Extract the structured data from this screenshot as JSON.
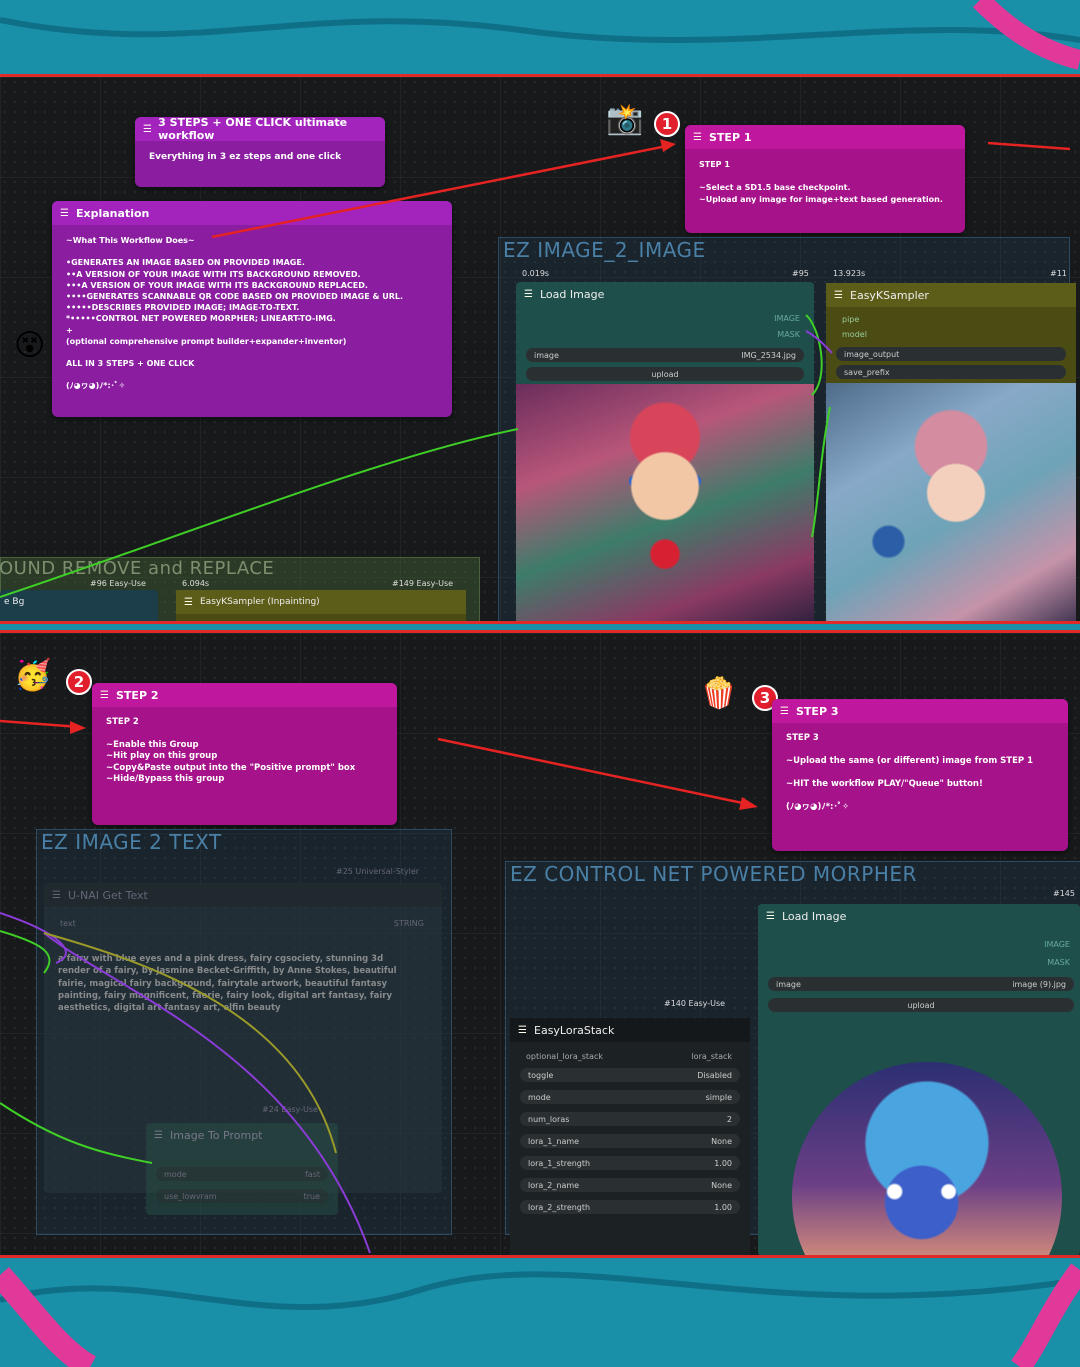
{
  "top_panel": {
    "title_note": {
      "header": "3 STEPS + ONE CLICK ultimate workflow",
      "body": "Everything in 3 ez steps and one click"
    },
    "explanation_note": {
      "header": "Explanation",
      "body": "~What This Workflow Does~\n\n•GENERATES AN IMAGE BASED ON PROVIDED IMAGE.\n••A VERSION OF YOUR IMAGE WITH ITS BACKGROUND REMOVED.\n•••A VERSION OF YOUR IMAGE WITH ITS BACKGROUND REPLACED.\n••••GENERATES SCANNABLE QR CODE BASED ON PROVIDED IMAGE & URL.\n•••••DESCRIBES PROVIDED IMAGE; IMAGE-TO-TEXT.\n*•••••CONTROL NET POWERED MORPHER; LINEART-TO-IMG.\n+\n(optional comprehensive prompt builder+expander+inventor)\n\nALL IN 3 STEPS + ONE CLICK\n\n(ﾉ◕ヮ◕)ﾉ*:･ﾟ✧"
    },
    "step1_note": {
      "header": "STEP 1",
      "body": "STEP 1\n\n~Select a SD1.5 base checkpoint.\n~Upload any image for image+text based generation."
    },
    "step1_badge": "1",
    "group_img2img": {
      "title": "EZ IMAGE_2_IMAGE"
    },
    "load_image_node": {
      "timer": "0.019s",
      "id": "#95",
      "title": "Load Image",
      "out1": "IMAGE",
      "out2": "MASK",
      "widget_label": "image",
      "widget_value": "IMG_2534.jpg",
      "upload": "upload"
    },
    "ksampler_node": {
      "timer": "13.923s",
      "id": "#11",
      "title": "EasyKSampler",
      "in1": "pipe",
      "in2": "model",
      "widget1": "image_output",
      "widget2": "save_prefix"
    },
    "bg_group": {
      "title": "OUND REMOVE and REPLACE",
      "node1_id": "#96 Easy-Use",
      "node1_label": "e Bg",
      "timer": "6.094s",
      "node2_id": "#149 Easy-Use",
      "node2_title": "EasyKSampler (Inpainting)"
    }
  },
  "bottom_panel": {
    "step2_badge": "2",
    "step2_note": {
      "header": "STEP 2",
      "body": "STEP 2\n\n~Enable this Group\n~Hit play on this group\n~Copy&Paste output into the \"Positive prompt\" box\n~Hide/Bypass this group"
    },
    "step3_badge": "3",
    "step3_note": {
      "header": "STEP 3",
      "body": "STEP 3\n\n~Upload the same (or different) image from STEP 1\n\n~HIT the workflow PLAY/\"Queue\" button!\n\n(ﾉ◕ヮ◕)ﾉ*:･ﾟ✧"
    },
    "group_img2text": {
      "title": "EZ IMAGE 2 TEXT",
      "node_id": "#25 Universal-Styler",
      "node_title": "U-NAI Get Text",
      "in_label": "text",
      "out_label": "STRING",
      "text": "a fairy with blue eyes and a pink dress, fairy cgsociety, stunning 3d render of a fairy, by Jasmine Becket-Griffith, by Anne Stokes, beautiful fairie, magical fairy background, fairytale artwork, beautiful fantasy painting, fairy magnificent, faerie, fairy look, digital art fantasy, fairy aesthetics, digital art fantasy art, elfin beauty",
      "node2_id": "#24 Easy-Use",
      "node2_title": "Image To Prompt",
      "node2_w1_label": "mode",
      "node2_w1_value": "fast",
      "node2_w2_label": "use_lowvram",
      "node2_w2_value": "true"
    },
    "group_morpher": {
      "title": "EZ CONTROL NET POWERED MORPHER",
      "id_right": "#145",
      "load_image": {
        "title": "Load Image",
        "out1": "IMAGE",
        "out2": "MASK",
        "widget_label": "image",
        "widget_value": "image (9).jpg",
        "upload": "upload"
      },
      "lora_node": {
        "id": "#140 Easy-Use",
        "title": "EasyLoraStack",
        "in_label": "optional_lora_stack",
        "out_label": "lora_stack",
        "rows": [
          {
            "label": "toggle",
            "value": "Disabled"
          },
          {
            "label": "mode",
            "value": "simple"
          },
          {
            "label": "num_loras",
            "value": "2"
          },
          {
            "label": "lora_1_name",
            "value": "None"
          },
          {
            "label": "lora_1_strength",
            "value": "1.00"
          },
          {
            "label": "lora_2_name",
            "value": "None"
          },
          {
            "label": "lora_2_strength",
            "value": "1.00"
          }
        ]
      }
    }
  }
}
